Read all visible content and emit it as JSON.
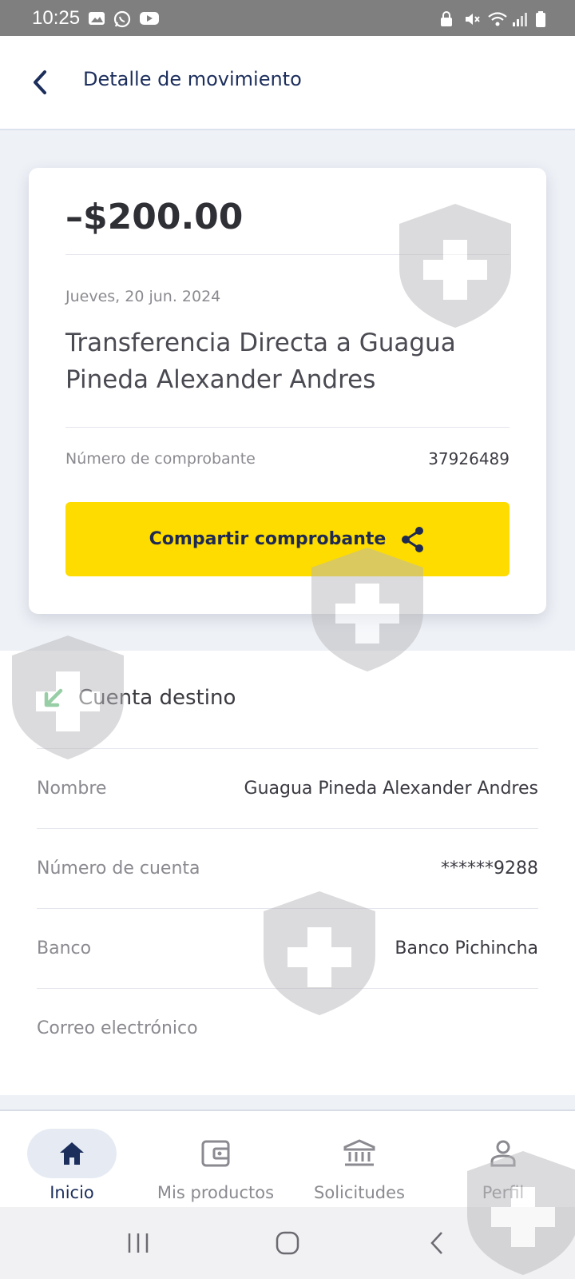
{
  "status_bar": {
    "time": "10:25",
    "left_icons": [
      "image-icon",
      "whatsapp-icon",
      "youtube-icon"
    ],
    "right_icons": [
      "lock-icon",
      "mute-icon",
      "wifi-icon",
      "signal-icon",
      "battery-icon"
    ]
  },
  "header": {
    "title": "Detalle de movimiento",
    "back_icon": "chevron-left-icon"
  },
  "transaction": {
    "amount": "–$200.00",
    "date": "Jueves, 20 jun. 2024",
    "description": "Transferencia Directa a Guagua Pineda Alexander Andres",
    "receipt_label": "Número de comprobante",
    "receipt_number": "37926489",
    "share_button_label": "Compartir comprobante"
  },
  "destination": {
    "title": "Cuenta destino",
    "rows": [
      {
        "label": "Nombre",
        "value": "Guagua Pineda Alexander Andres"
      },
      {
        "label": "Número de cuenta",
        "value": "******9288"
      },
      {
        "label": "Banco",
        "value": "Banco Pichincha"
      },
      {
        "label": "Correo electrónico",
        "value": ""
      }
    ]
  },
  "bottom_nav": {
    "items": [
      {
        "label": "Inicio",
        "icon": "home-icon",
        "active": true
      },
      {
        "label": "Mis productos",
        "icon": "wallet-icon",
        "active": false
      },
      {
        "label": "Solicitudes",
        "icon": "bank-icon",
        "active": false
      },
      {
        "label": "Perfil",
        "icon": "person-icon",
        "active": false
      }
    ]
  },
  "colors": {
    "accent_yellow": "#fedc00",
    "navy": "#1c2e5c",
    "arrow_green": "#2e9e4a",
    "status_bar": "#7f7f7f"
  }
}
